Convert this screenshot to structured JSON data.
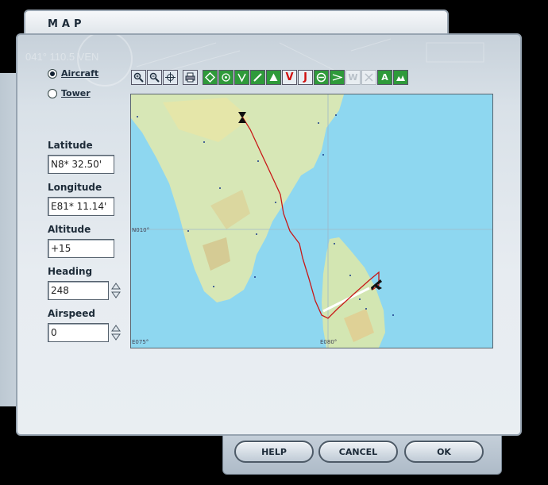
{
  "window": {
    "title": "MAP"
  },
  "deco": {
    "heading_ghost": "041° 110.5 VEN"
  },
  "view_mode": {
    "aircraft_label": "Aircraft",
    "tower_label": "Tower",
    "selected": "aircraft"
  },
  "fields": {
    "latitude": {
      "label": "Latitude",
      "value": "N8* 32.50'"
    },
    "longitude": {
      "label": "Longitude",
      "value": "E81* 11.14'"
    },
    "altitude": {
      "label": "Altitude",
      "value": "+15"
    },
    "heading": {
      "label": "Heading",
      "value": "248"
    },
    "airspeed": {
      "label": "Airspeed",
      "value": "0"
    }
  },
  "toolbar": {
    "tools": [
      {
        "name": "zoom-in-icon",
        "style": "lite"
      },
      {
        "name": "zoom-out-icon",
        "style": "lite"
      },
      {
        "name": "center-aircraft-icon",
        "style": "lite"
      },
      {
        "name": "print-icon",
        "style": "lite"
      },
      {
        "name": "vor-icon",
        "style": "grn"
      },
      {
        "name": "ndb-icon",
        "style": "grn"
      },
      {
        "name": "ils-icon",
        "style": "grn"
      },
      {
        "name": "runway-icon",
        "style": "grn"
      },
      {
        "name": "intersection-icon",
        "style": "grn"
      },
      {
        "name": "victor-airway-icon",
        "style": "red",
        "glyph": "V"
      },
      {
        "name": "jet-airway-icon",
        "style": "red",
        "glyph": "J"
      },
      {
        "name": "airport-icon",
        "style": "grn"
      },
      {
        "name": "approach-icon",
        "style": "grn"
      },
      {
        "name": "weather-icon",
        "style": "dis",
        "glyph": "W"
      },
      {
        "name": "close-weather-icon",
        "style": "dis"
      },
      {
        "name": "text-labels-icon",
        "style": "grn",
        "glyph": "A"
      },
      {
        "name": "terrain-icon",
        "style": "grn"
      }
    ]
  },
  "map": {
    "lat_gridline_label": "N010°",
    "lon_left_label": "E075°",
    "lon_right_label": "E080°",
    "colors": {
      "water": "#8ed7f0",
      "land": "#d5e6b4",
      "route": "#c81818",
      "runway": "#ffffff"
    }
  },
  "buttons": {
    "help": "HELP",
    "cancel": "CANCEL",
    "ok": "OK"
  }
}
